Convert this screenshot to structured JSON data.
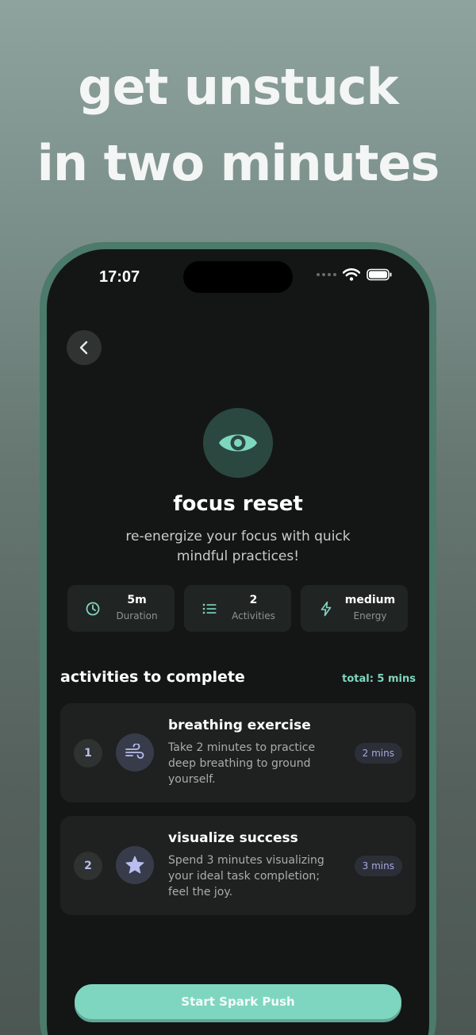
{
  "promo": {
    "line1": "get unstuck",
    "line2": "in two minutes"
  },
  "status_bar": {
    "time": "17:07"
  },
  "hero": {
    "icon": "eye-icon",
    "title": "focus reset",
    "subtitle": "re-energize your focus with quick mindful practices!"
  },
  "stats": [
    {
      "icon": "clock-icon",
      "value": "5m",
      "label": "Duration"
    },
    {
      "icon": "list-icon",
      "value": "2",
      "label": "Activities"
    },
    {
      "icon": "bolt-icon",
      "value": "medium",
      "label": "Energy"
    }
  ],
  "activities_section": {
    "title": "activities to complete",
    "total": "total: 5 mins"
  },
  "activities": [
    {
      "number": "1",
      "icon": "wind-icon",
      "title": "breathing exercise",
      "description": "Take 2 minutes to practice deep breathing to ground yourself.",
      "duration": "2 mins"
    },
    {
      "number": "2",
      "icon": "star-icon",
      "title": "visualize success",
      "description": "Spend 3 minutes visualizing your ideal task completion; feel the joy.",
      "duration": "3 mins"
    }
  ],
  "cta": {
    "label": "Start Spark Push"
  },
  "colors": {
    "accent": "#7fd6c0",
    "frame": "#4c7a6b",
    "screen_bg": "#141615",
    "badge_text": "#a8aadf"
  }
}
